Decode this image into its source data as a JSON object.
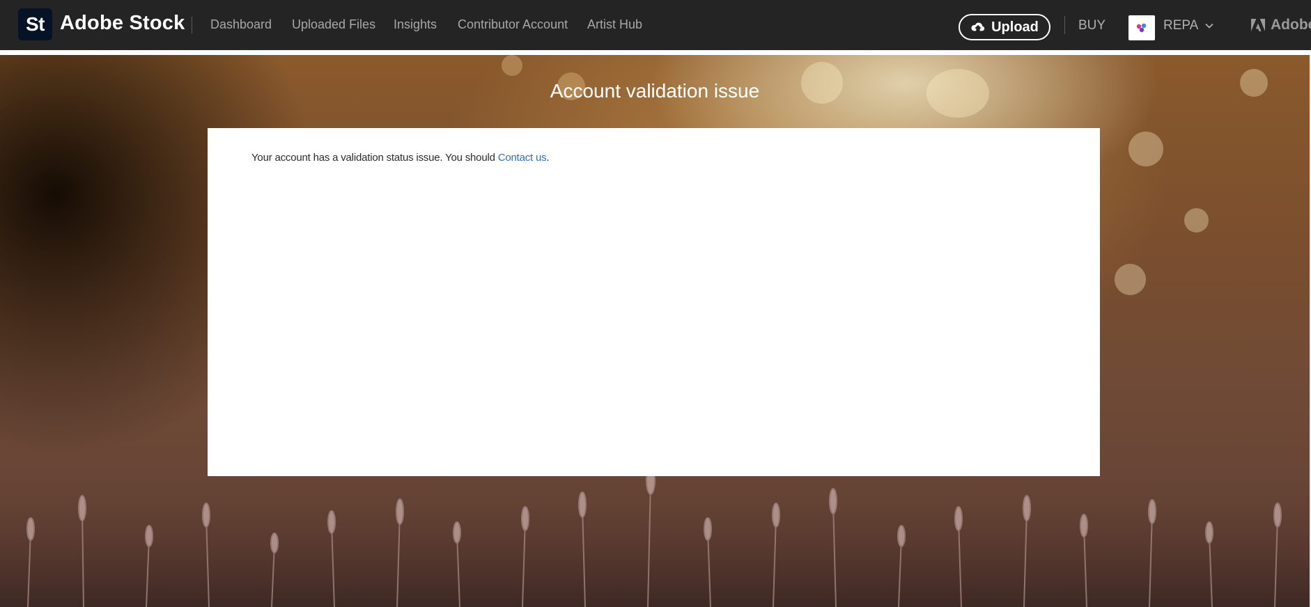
{
  "header": {
    "logo_text": "St",
    "brand_name": "Adobe Stock",
    "nav": [
      {
        "label": "Dashboard"
      },
      {
        "label": "Uploaded Files"
      },
      {
        "label": "Insights"
      },
      {
        "label": "Contributor Account"
      },
      {
        "label": "Artist Hub"
      }
    ],
    "upload_label": "Upload",
    "buy_label": "BUY",
    "user_name": "REPA",
    "adobe_label": "Adobe"
  },
  "main": {
    "title": "Account validation issue",
    "message_prefix": "Your account has a validation status issue. You should ",
    "contact_link": "Contact us",
    "message_suffix": "."
  },
  "colors": {
    "topbar": "#242424",
    "link": "#2d6fbf",
    "logo_bg": "#061226"
  },
  "icons": {
    "upload": "cloud-upload-icon",
    "chevron": "chevron-down-icon",
    "adobe": "adobe-logo-icon"
  }
}
